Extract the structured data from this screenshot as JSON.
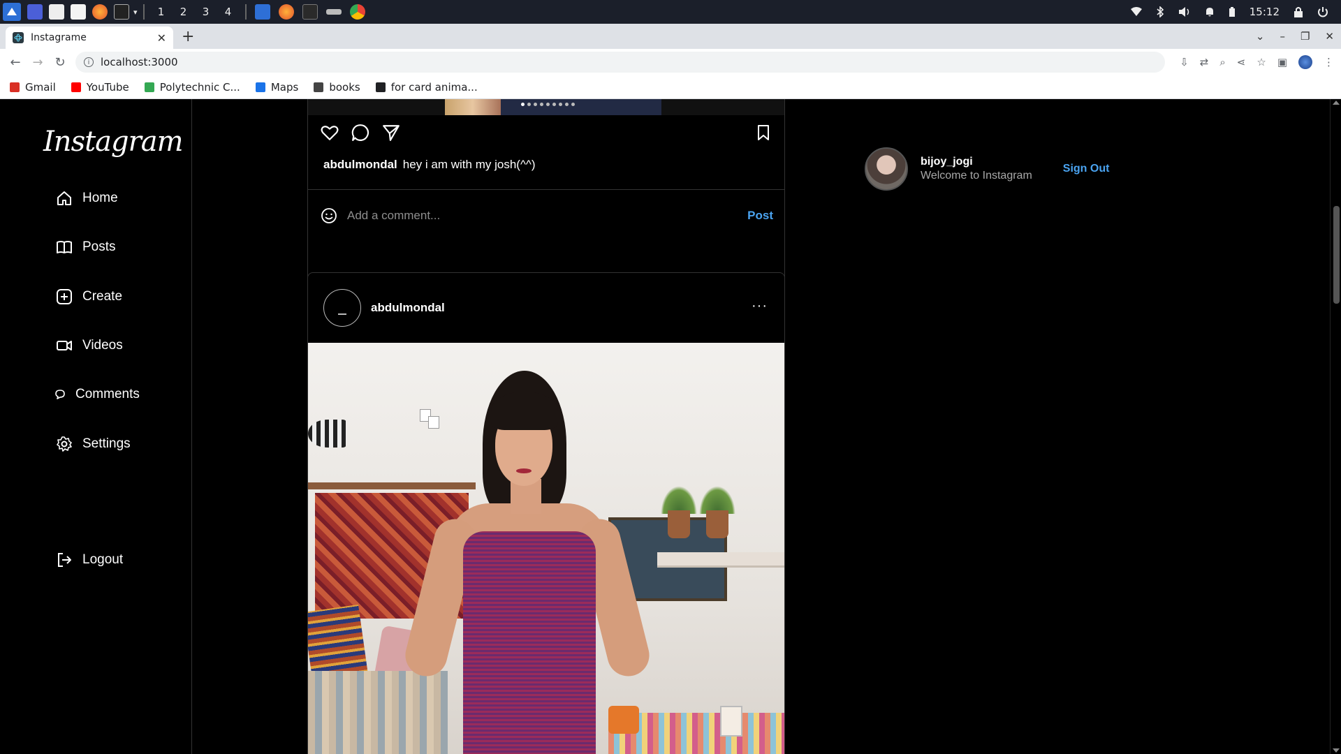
{
  "os": {
    "workspaces": [
      "1",
      "2",
      "3",
      "4"
    ],
    "clock": "15:12"
  },
  "browser": {
    "tab_title": "Instagrame",
    "url": "localhost:3000",
    "bookmarks": [
      {
        "label": "Gmail",
        "icon": "gmail-icon",
        "color": "#d93025"
      },
      {
        "label": "YouTube",
        "icon": "youtube-icon",
        "color": "#ff0000"
      },
      {
        "label": "Polytechnic C...",
        "icon": "polytechnic-icon",
        "color": "#34a853"
      },
      {
        "label": "Maps",
        "icon": "maps-icon",
        "color": "#1a73e8"
      },
      {
        "label": "books",
        "icon": "books-icon",
        "color": "#444444"
      },
      {
        "label": "for card anima...",
        "icon": "codepen-icon",
        "color": "#202124"
      }
    ]
  },
  "sidebar": {
    "logo": "Instagram",
    "items": [
      {
        "label": "Home",
        "icon": "home-icon"
      },
      {
        "label": "Posts",
        "icon": "book-icon"
      },
      {
        "label": "Create",
        "icon": "plus-square-icon"
      },
      {
        "label": "Videos",
        "icon": "video-icon"
      },
      {
        "label": "Comments",
        "icon": "comment-icon"
      },
      {
        "label": "Settings",
        "icon": "gear-icon"
      },
      {
        "label": "Logout",
        "icon": "logout-icon"
      }
    ]
  },
  "post1": {
    "username": "abdulmondal",
    "caption": "hey i am with my josh(^^)",
    "comment_placeholder": "Add a comment...",
    "post_label": "Post"
  },
  "post2": {
    "username": "abdulmondal",
    "more": "···"
  },
  "profile": {
    "username": "bijoy_jogi",
    "subtitle": "Welcome to Instagram",
    "signout": "Sign Out"
  },
  "colors": {
    "accent_blue": "#4aa3f0",
    "background": "#000000"
  }
}
